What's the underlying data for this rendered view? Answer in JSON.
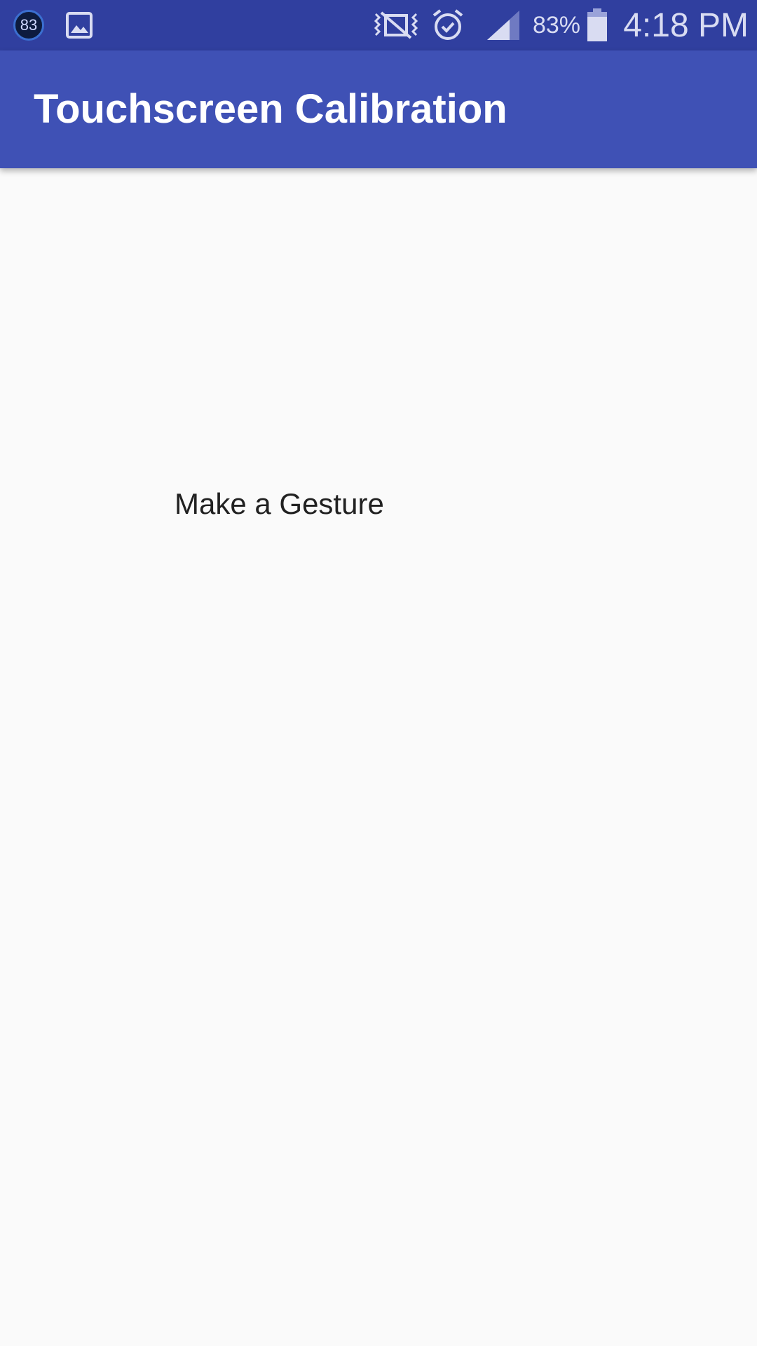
{
  "status_bar": {
    "notification_badge": "83",
    "icons": [
      "gallery-icon",
      "vibrate-off-icon",
      "alarm-icon",
      "signal-icon",
      "battery-icon"
    ],
    "battery_percent": "83%",
    "time": "4:18 PM",
    "battery_level": 0.83,
    "color": "#303f9f"
  },
  "app_bar": {
    "title": "Touchscreen Calibration",
    "color": "#3f51b5"
  },
  "main": {
    "prompt": "Make a Gesture"
  }
}
